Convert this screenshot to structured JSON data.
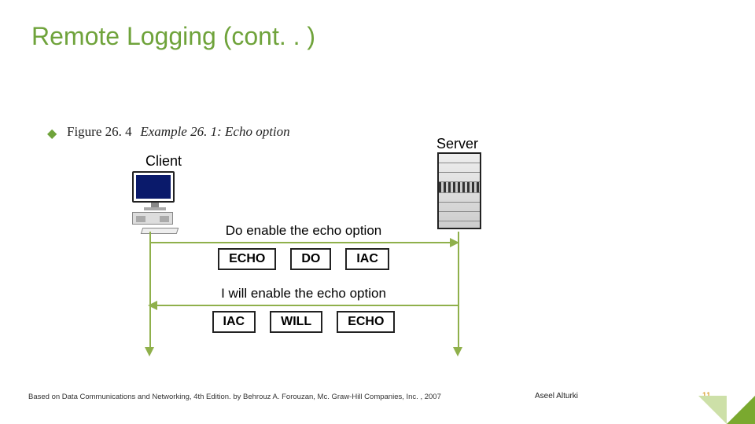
{
  "title": "Remote Logging (cont. . )",
  "figure": {
    "number": "Figure 26. 4",
    "caption": "Example 26. 1: Echo option"
  },
  "labels": {
    "client": "Client",
    "server": "Server"
  },
  "messages": {
    "request": {
      "caption": "Do enable the echo option",
      "fields": [
        "ECHO",
        "DO",
        "IAC"
      ]
    },
    "reply": {
      "caption": "I will enable the echo option",
      "fields": [
        "IAC",
        "WILL",
        "ECHO"
      ]
    }
  },
  "footer": {
    "citation": "Based on Data Communications and Networking, 4th Edition. by Behrouz A. Forouzan,   Mc. Graw-Hill Companies, Inc. , 2007",
    "author": "Aseel Alturki",
    "page": "11"
  }
}
